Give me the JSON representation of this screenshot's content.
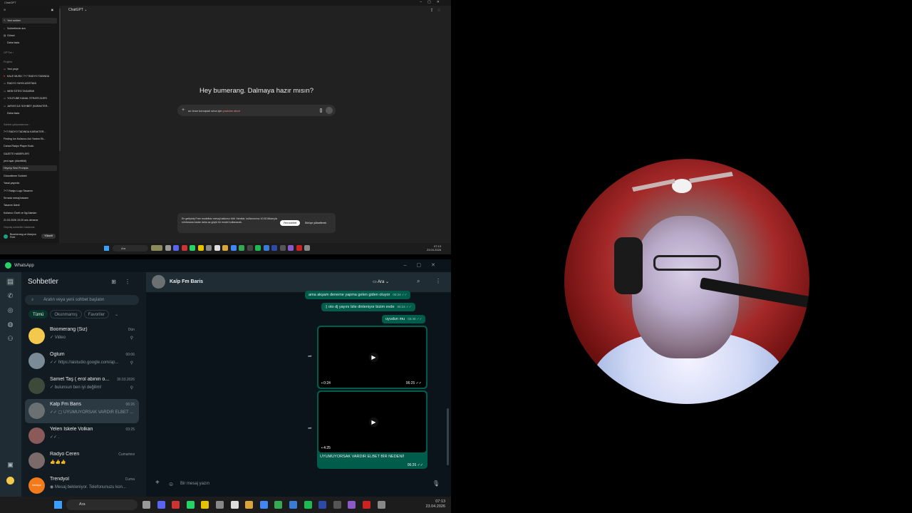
{
  "chatgpt": {
    "window_title": "ChatGPT",
    "model_label": "ChatGPT ⌄",
    "greeting": "Hey bumerang. Dalmaya hazır mısın?",
    "input": {
      "text_part1": "az önce konuştuk  sılva   için  ",
      "text_highlight": "youtube short"
    },
    "sidebar": {
      "items": [
        {
          "icon": "edit-icon",
          "label": "Yeni sohbet"
        },
        {
          "icon": "search-icon",
          "label": "Sohbetlerde ara"
        },
        {
          "icon": "image-icon",
          "label": "Görsel"
        },
        {
          "icon": "more-icon",
          "label": "Daha fazla"
        }
      ],
      "gpts_header": "GPT'ler ›",
      "projects_header": "Projeler",
      "projects": [
        "Yeni proje",
        "KALE MUSIC 7+7 RADYO TADINDA",
        "RADYO YAYIN ASİSTANI",
        "WEB SİTESİ TASARIMI",
        "YOUTUBE KANAL STRATEJİLERİ",
        "JARVIS İLE SOHBET (KARAKTER...",
        "Daha fazla"
      ],
      "recent_header": "Sohbet çalışmalarınız ›",
      "recent": [
        "7+7 RADYO TADINDA KARAKTER...",
        "Finding Ion Kullanıcı Adı Yardım Ek...",
        "Canva Radyo Player Kodu",
        "GAZETE HABERLERİ",
        "yeni ayar  (düzeltildi)",
        "Heyclıp Sesi Prompta",
        "Güncelleme Sohbeti",
        "Yasal yayında",
        "7+7 Radyo Logo Tasarımı",
        "Sırrada mesaj basamı",
        "Tasarım İstedi",
        "Kullanıcı Özeti ve İlgi Alanları",
        "21.03.2026 10:20 ses deneme",
        "Geçmiş sohbetler hakkında"
      ]
    },
    "user": {
      "name": "Boomerang ve Aksiyon",
      "plan": "Free",
      "upgrade_label": "Yükselt"
    },
    "notice": {
      "text": "En gelişmiş Free modeliniz mesaj hakkınız bitti. Yanıtlar, kullanımınız 10:30 itibarıyla sıfırlanana kadar daha az güçlü bir model kullanacak.",
      "primary_label": "Yeni sohbet",
      "secondary_label": "Sürüye yükseltmek"
    },
    "taskbar": {
      "search_label": "Ara",
      "time": "07:13",
      "date": "23.04.2026"
    }
  },
  "whatsapp": {
    "window_title": "WhatsApp",
    "list_title": "Sohbetler",
    "search_placeholder": "Aratın veya yeni sohbet başlatın",
    "filters": [
      "Tümü",
      "Okunmamış",
      "Favoriler",
      "⌄"
    ],
    "chats": [
      {
        "name": "Boomerang (Siz)",
        "time": "Dün",
        "preview": "✓ Video",
        "pinned": true,
        "avatar_color": "#f2c94c"
      },
      {
        "name": "Oglum",
        "time": "00:06",
        "preview": "✓✓ https://aistudio.google.com/ap...",
        "pinned": true,
        "avatar_color": "#7a8a96"
      },
      {
        "name": "Samet Taş ( erol abinin o...",
        "time": "30.03.2026",
        "preview": "✓ bulunsun ben iyi değilim!",
        "pinned": true,
        "avatar_color": "#3d4a3a"
      },
      {
        "name": "Kalp Fm Baris",
        "time": "06:26",
        "preview": "✓✓ ▢ UYUMUYORSAK VARDIR ELBET ...",
        "pinned": false,
        "avatar_color": "#6b7173"
      },
      {
        "name": "Yelen Iskele Volkan",
        "time": "03:25",
        "preview": "✓✓ .",
        "pinned": false,
        "avatar_color": "#8a5a5a"
      },
      {
        "name": "Radyo Ceren",
        "time": "Cumartesi",
        "preview": "👍👍👍",
        "pinned": false,
        "avatar_color": "#7a6a6a"
      },
      {
        "name": "Trendyol",
        "time": "Cuma",
        "preview": "◉ Mesaj bekleniyor. Telefonunuzu kon...",
        "pinned": false,
        "avatar_color": "#f27a1a",
        "avatar_text": "trendyol"
      }
    ],
    "conversation": {
      "name": "Kalp Fm Baris",
      "call_label": "Ara",
      "messages": [
        {
          "text": "ama akşam  deneme yapma  gelen giden oluyor",
          "time": "00:24 ✓✓"
        },
        {
          "text": ":) oto dj yayını bile dinleniyor bizim evde",
          "time": "00:24 ✓✓"
        },
        {
          "text": "uyudun mu",
          "time": "03:40 ✓✓"
        }
      ],
      "videos": [
        {
          "duration": "0:24",
          "time": "06:25 ✓✓",
          "caption": ""
        },
        {
          "duration": "4:25",
          "time": "06:26 ✓✓",
          "caption": "UYUMUYORSAK VARDIR ELBET BİR NEDENİ!"
        }
      ],
      "compose_placeholder": "Bir mesaj yazın"
    },
    "taskbar": {
      "search_label": "Ara",
      "time": "07:13",
      "date": "23.04.2026"
    }
  },
  "colors": {
    "wa_accent": "#25d366",
    "wa_bubble": "#005c4b",
    "wa_bg": "#0b141a",
    "cg_bg": "#212121"
  }
}
